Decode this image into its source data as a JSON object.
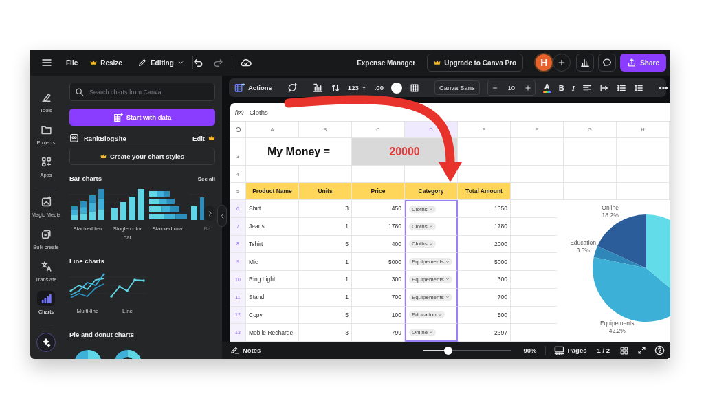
{
  "topbar": {
    "file": "File",
    "resize": "Resize",
    "mode": "Editing",
    "undo": {
      "disabled": false
    },
    "redo": {
      "disabled": true
    },
    "title": "Expense Manager",
    "upgrade": "Upgrade to Canva Pro",
    "avatar": "H",
    "share": "Share"
  },
  "rail": {
    "groups": [
      [
        {
          "label": "Tools",
          "selected": false
        },
        {
          "label": "Projects",
          "selected": false
        },
        {
          "label": "Apps",
          "selected": false
        }
      ],
      [
        {
          "label": "Magic Media",
          "selected": false
        },
        {
          "label": "Bulk create",
          "selected": false
        },
        {
          "label": "Translate",
          "selected": false
        },
        {
          "label": "Charts",
          "selected": true
        }
      ]
    ]
  },
  "panel": {
    "search": {
      "placeholder": "Search charts from Canva"
    },
    "start_button": "Start with data",
    "brand": {
      "name": "RankBlogSite",
      "action": "Edit"
    },
    "styles_button": "Create your chart styles",
    "sections": [
      {
        "title": "Bar charts",
        "action": "See all",
        "items": [
          {
            "kind": "stacked-bar",
            "label": "Stacked bar"
          },
          {
            "kind": "single-bar",
            "label": "Single color bar"
          },
          {
            "kind": "stacked-row",
            "label": "Stacked row"
          },
          {
            "kind": "bar",
            "label": "Ba"
          }
        ]
      },
      {
        "title": "Line charts",
        "items": [
          {
            "kind": "multi-line",
            "label": "Multi-line"
          },
          {
            "kind": "line",
            "label": "Line"
          }
        ]
      },
      {
        "title": "Pie and donut charts",
        "items": [
          {
            "kind": "pie"
          },
          {
            "kind": "donut"
          }
        ]
      }
    ]
  },
  "toolbar": {
    "actions": "Actions",
    "number_format": "123",
    "decimals": ".00",
    "font": "Canva Sans",
    "size": "10",
    "color_letter": "A",
    "bold": "B",
    "italic": "I"
  },
  "sheet": {
    "formula": {
      "label": "f(x)",
      "value": "Cloths"
    },
    "columns": [
      {
        "label": "A",
        "selected": false
      },
      {
        "label": "B",
        "selected": false
      },
      {
        "label": "C",
        "selected": false
      },
      {
        "label": "D",
        "selected": true
      },
      {
        "label": "E",
        "selected": false
      },
      {
        "label": "F",
        "selected": false
      },
      {
        "label": "G",
        "selected": false
      },
      {
        "label": "H",
        "selected": false
      }
    ],
    "title_row": {
      "number": "3",
      "label": "My Money =",
      "amount": "20000"
    },
    "empty_row": {
      "number": "4"
    },
    "header_row": {
      "number": "5",
      "cells": [
        "Product Name",
        "Units",
        "Price",
        "Category",
        "Total Amount"
      ]
    },
    "rows": [
      {
        "number": "6",
        "selected": true,
        "product": "Shirt",
        "units": "3",
        "price": "450",
        "category": "Cloths",
        "total": "1350"
      },
      {
        "number": "7",
        "selected": true,
        "product": "Jeans",
        "units": "1",
        "price": "1780",
        "category": "Cloths",
        "total": "1780"
      },
      {
        "number": "8",
        "selected": true,
        "product": "Tshirt",
        "units": "5",
        "price": "400",
        "category": "Cloths",
        "total": "2000"
      },
      {
        "number": "9",
        "selected": true,
        "product": "Mic",
        "units": "1",
        "price": "5000",
        "category": "Equipements",
        "total": "5000"
      },
      {
        "number": "10",
        "selected": true,
        "product": "Ring Light",
        "units": "1",
        "price": "300",
        "category": "Equipements",
        "total": "300"
      },
      {
        "number": "11",
        "selected": true,
        "product": "Stand",
        "units": "1",
        "price": "700",
        "category": "Equipements",
        "total": "700"
      },
      {
        "number": "12",
        "selected": true,
        "product": "Copy",
        "units": "5",
        "price": "100",
        "category": "Education",
        "total": "500"
      },
      {
        "number": "13",
        "selected": true,
        "product": "Mobile Recharge",
        "units": "3",
        "price": "799",
        "category": "Online",
        "total": "2397"
      }
    ],
    "chart": {
      "chart_data": {
        "type": "pie",
        "categories": [
          "Online",
          "Education",
          "Equipements",
          null
        ],
        "values": [
          18.2,
          3.5,
          42.2,
          36.1
        ],
        "value_labels": [
          "18.2%",
          "3.5%",
          "42.2%",
          null
        ]
      }
    }
  },
  "bottom": {
    "notes": "Notes",
    "zoom": {
      "level": 0.28
    },
    "zoom_reading": "90%",
    "pages": "Pages",
    "page": "1 / 2"
  }
}
